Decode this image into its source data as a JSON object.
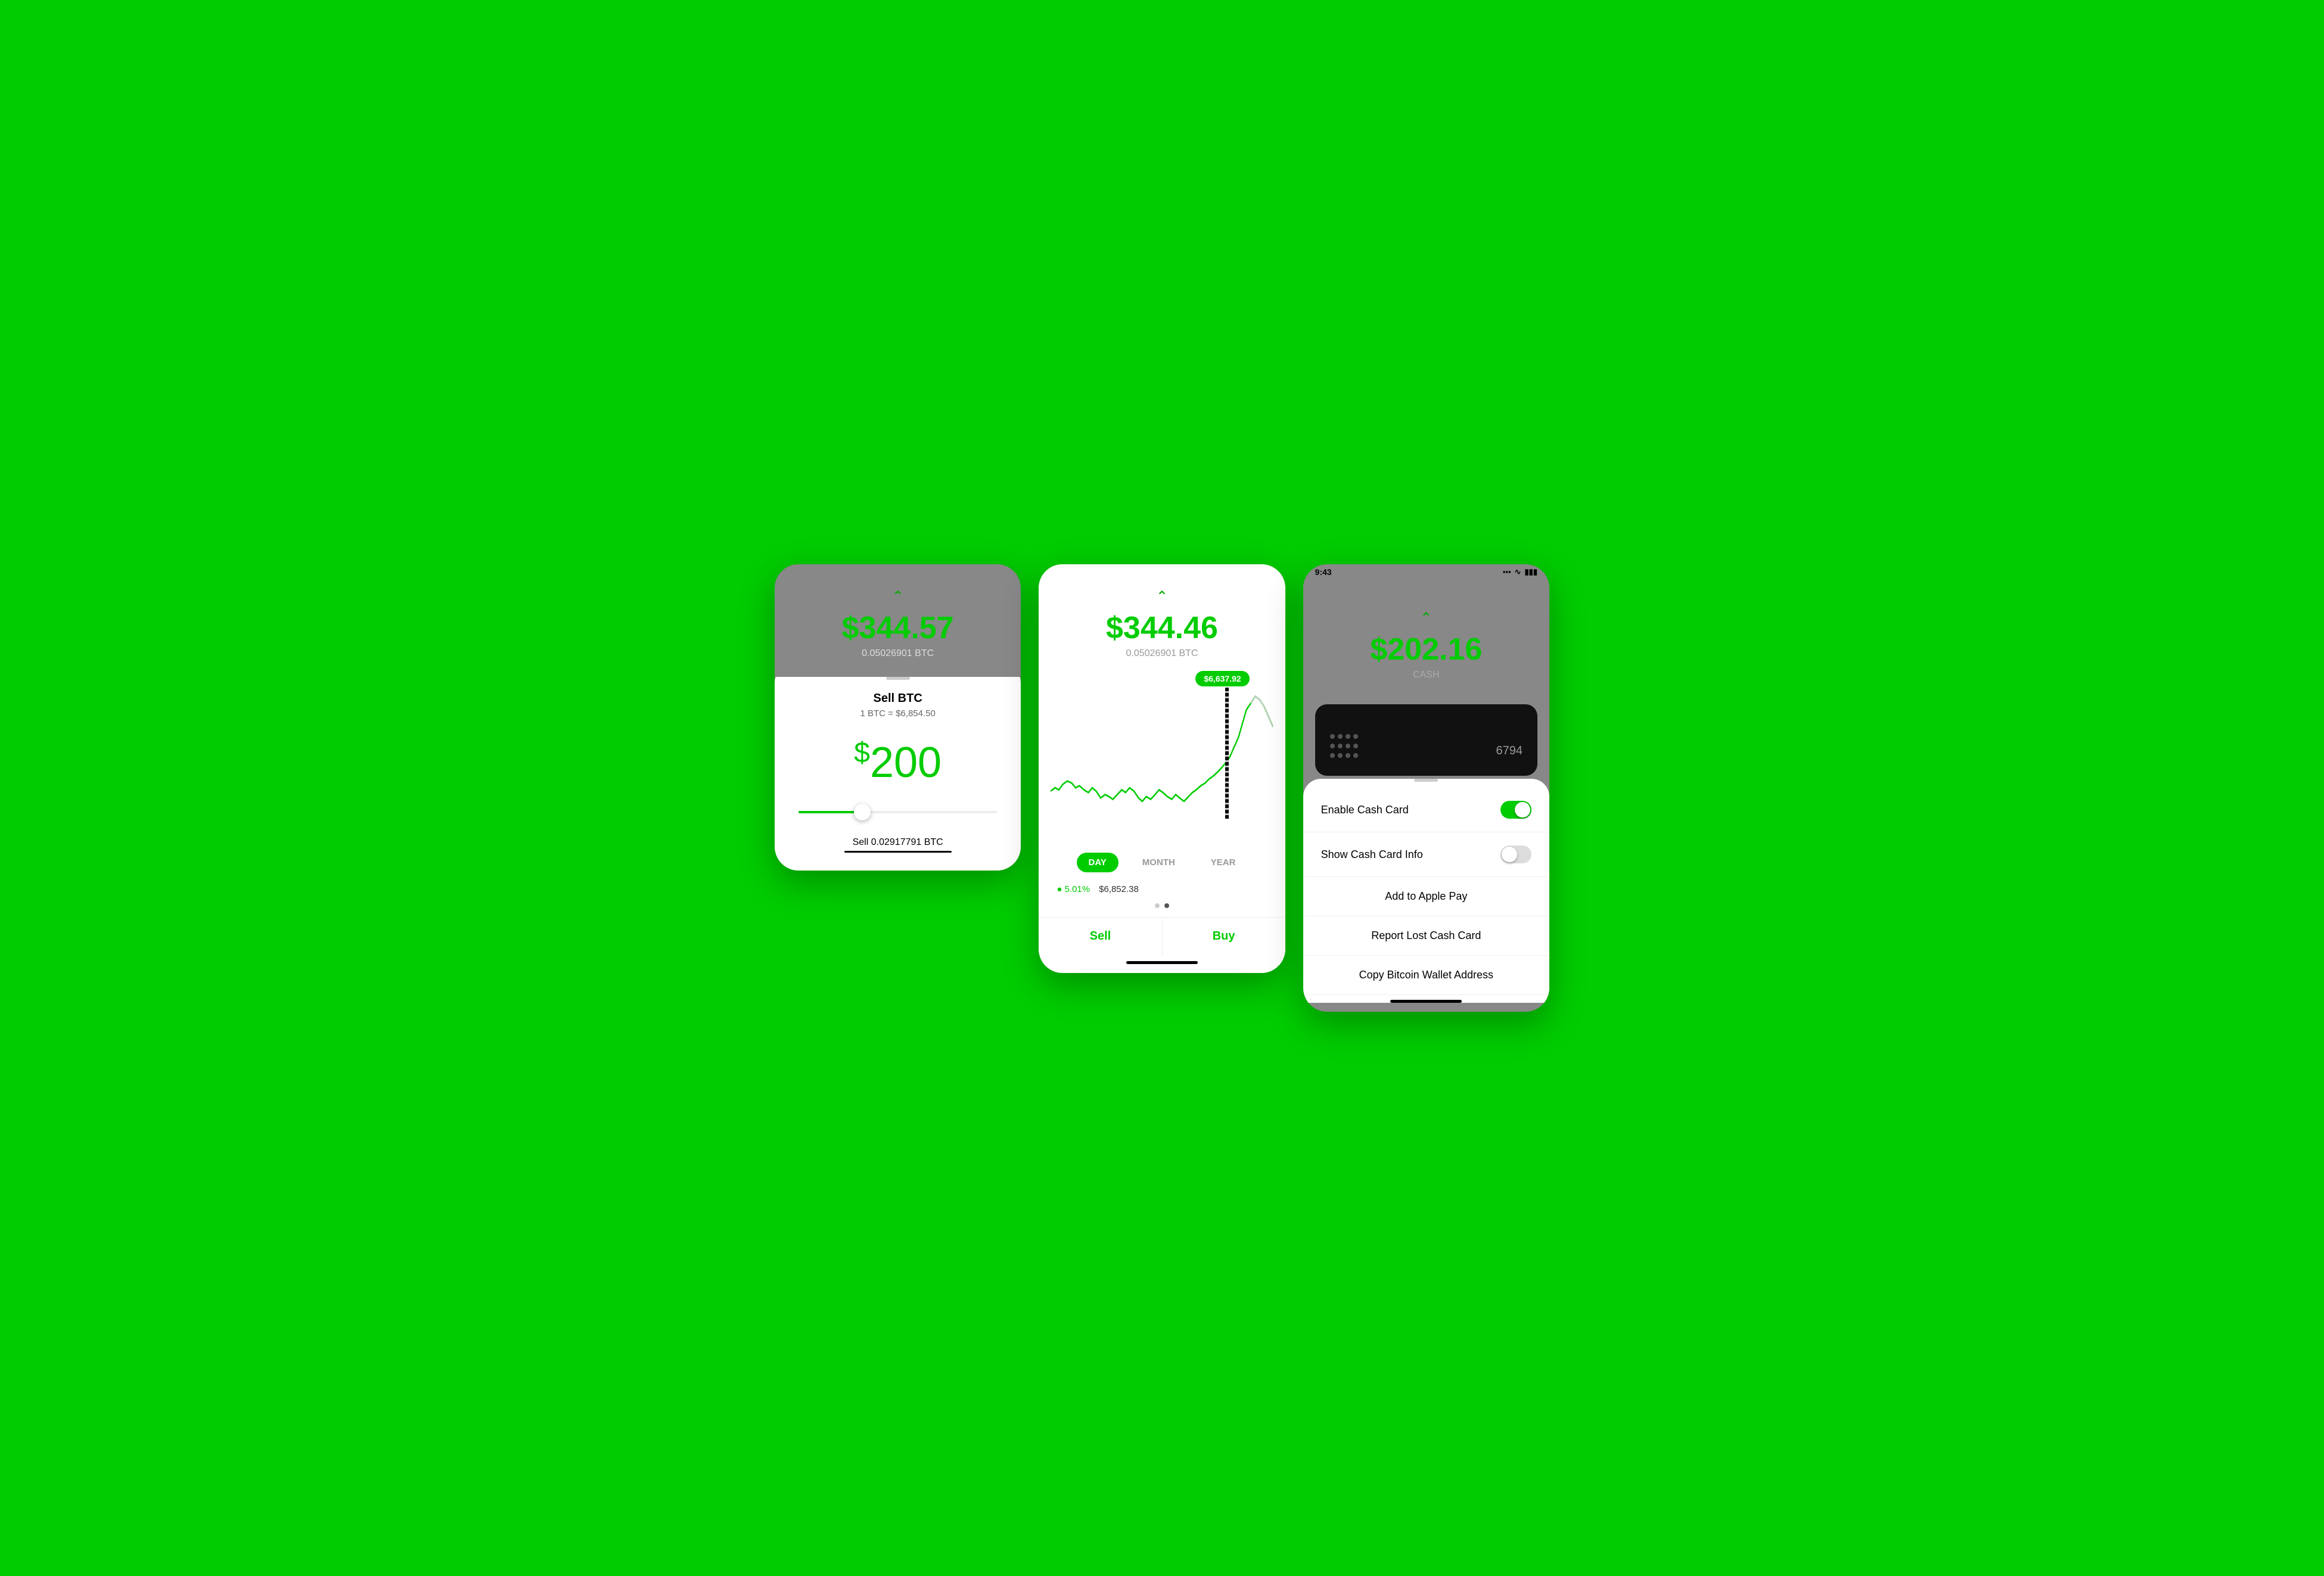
{
  "screen1": {
    "amount_big": "$344.57",
    "amount_btc": "0.05026901 BTC",
    "sheet_title": "Sell BTC",
    "rate": "1 BTC = $6,854.50",
    "sell_amount": "200",
    "sell_btc_label": "Sell 0.02917791 BTC"
  },
  "screen2": {
    "amount_big": "$344.46",
    "amount_btc": "0.05026901 BTC",
    "tooltip": "$6,637.92",
    "tabs": [
      "DAY",
      "MONTH",
      "YEAR"
    ],
    "active_tab": "DAY",
    "change_pct": "● 5.01%",
    "price": "$6,852.38",
    "sell_label": "Sell",
    "buy_label": "Buy"
  },
  "screen3": {
    "status_time": "9:43",
    "amount_big": "$202.16",
    "cash_label": "CASH",
    "card_number": "6794",
    "menu_items": [
      {
        "label": "Enable Cash Card",
        "type": "toggle-on"
      },
      {
        "label": "Show Cash Card Info",
        "type": "toggle-off"
      },
      {
        "label": "Add to Apple Pay",
        "type": "arrow"
      },
      {
        "label": "Report Lost Cash Card",
        "type": "arrow"
      },
      {
        "label": "Copy Bitcoin Wallet Address",
        "type": "arrow"
      }
    ]
  }
}
